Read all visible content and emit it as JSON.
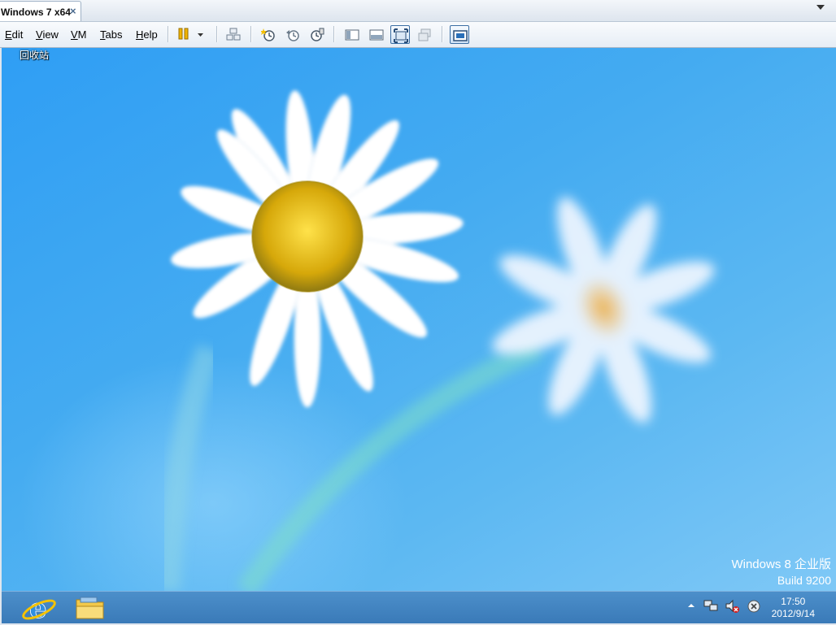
{
  "tab": {
    "title": "Windows 7 x64",
    "close_glyph": "×"
  },
  "menu": {
    "edit": "Edit",
    "view": "View",
    "vm": "VM",
    "tabs": "Tabs",
    "help": "Help"
  },
  "toolbar": {
    "icons": [
      "pause-icon",
      "dropdown-icon",
      "send-keys-icon",
      "snapshot-icon",
      "revert-snapshot-icon",
      "snapshot-manager-icon",
      "normal-view-icon",
      "quick-switch-icon",
      "fullscreen-icon",
      "unity-icon",
      "console-view-icon"
    ]
  },
  "desktop": {
    "recycle_bin_label": "回收站",
    "watermark_os": "Windows 8 企业版",
    "watermark_build": "Build 9200"
  },
  "taskbar": {
    "clock_time": "17:50",
    "clock_date": "2012/9/14",
    "tray_icons": [
      "show-hidden-icons-icon",
      "network-icon",
      "volume-muted-icon",
      "action-center-icon"
    ],
    "pinned": [
      "internet-explorer-icon",
      "file-explorer-icon"
    ]
  }
}
